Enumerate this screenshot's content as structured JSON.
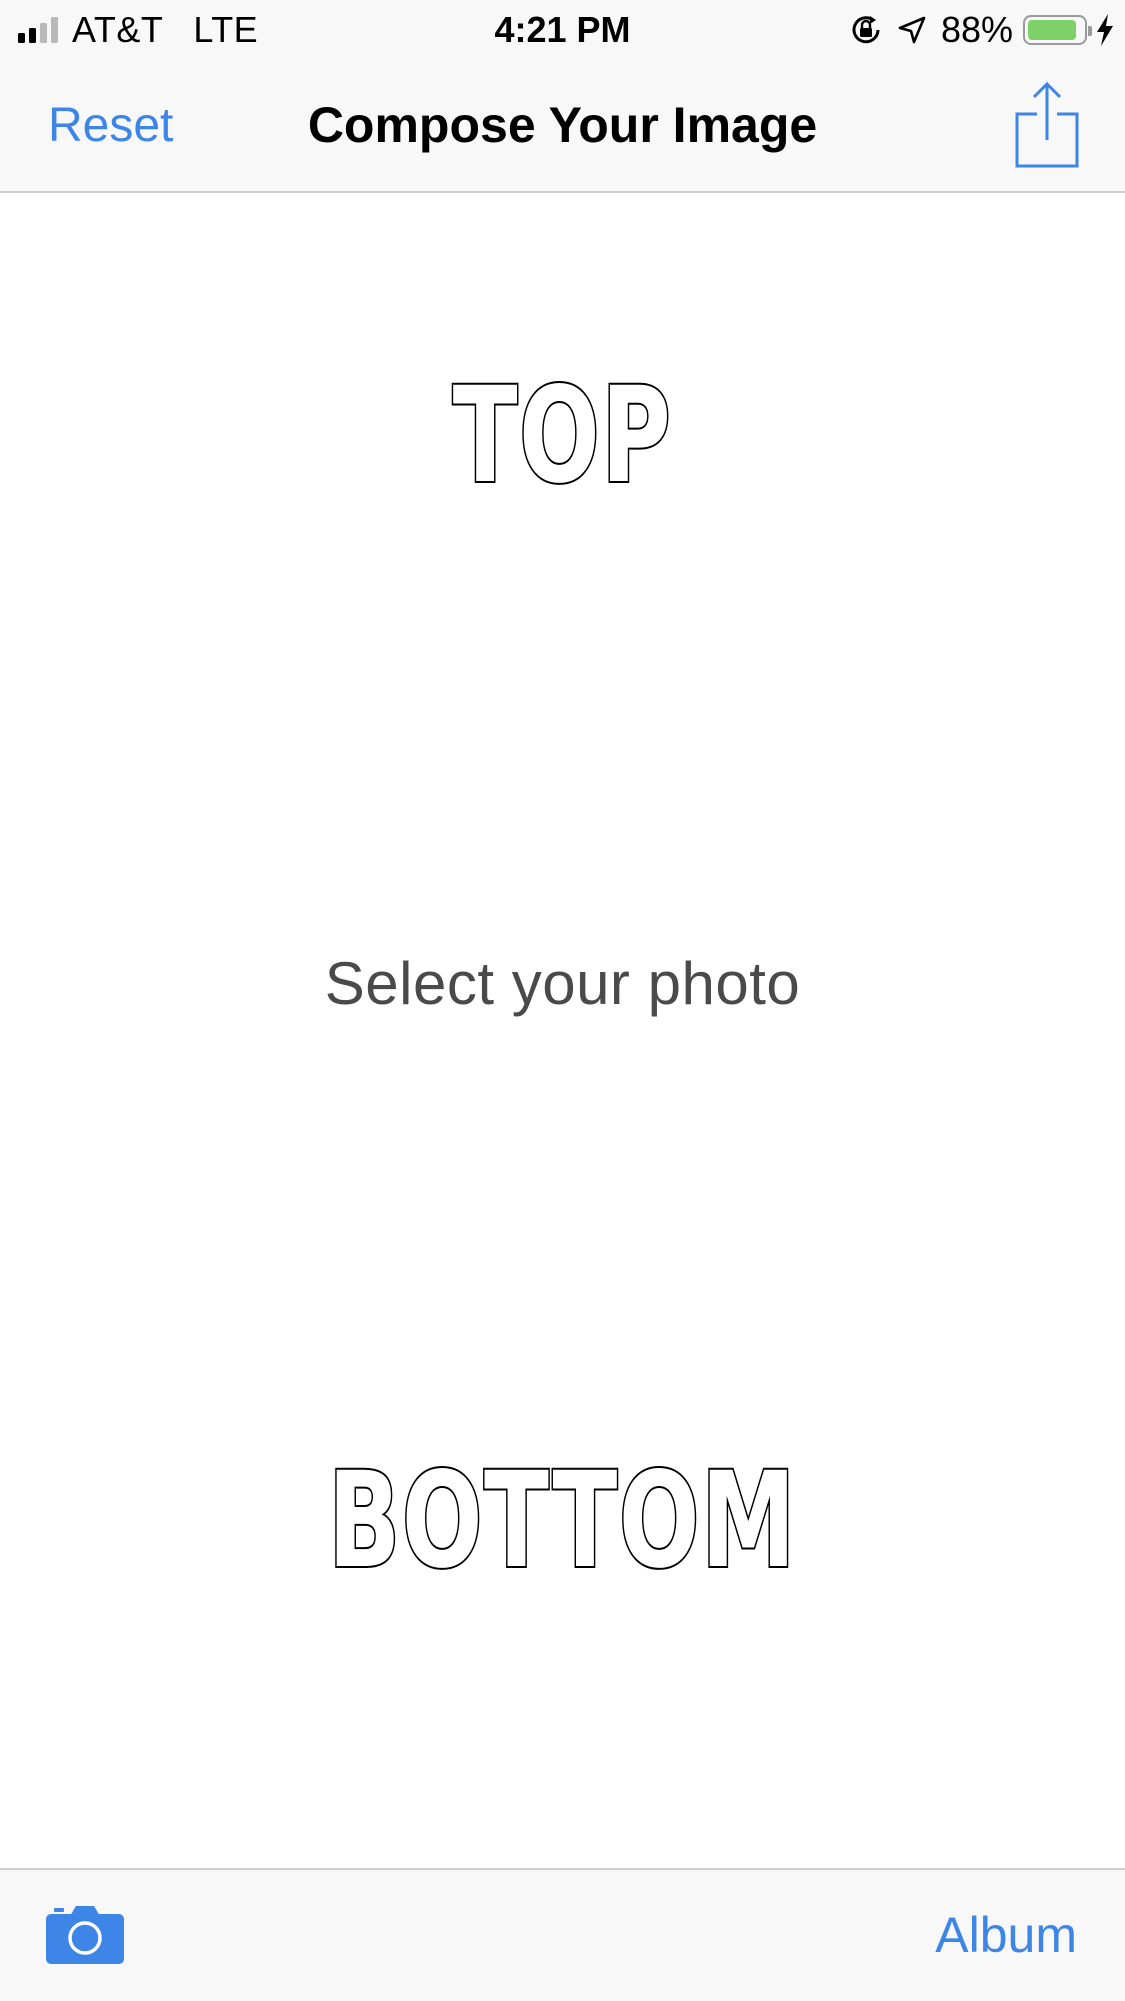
{
  "colors": {
    "accent": "#3d85e6",
    "battery": "#7ed168",
    "placeholder": "#4a4a4a"
  },
  "status_bar": {
    "carrier": "AT&T",
    "network": "LTE",
    "time": "4:21 PM",
    "battery_percent": "88%",
    "battery_level": 0.88,
    "signal_bars_filled": 2,
    "signal_bars_total": 4,
    "icons": [
      "signal-icon",
      "orientation-lock-icon",
      "location-arrow-icon",
      "battery-icon",
      "charging-bolt-icon"
    ]
  },
  "nav_bar": {
    "left_button": "Reset",
    "title": "Compose Your Image",
    "right_icon": "share-icon"
  },
  "canvas": {
    "top_text": "TOP",
    "placeholder": "Select your photo",
    "bottom_text": "BOTTOM"
  },
  "toolbar": {
    "left_icon": "camera-icon",
    "right_button": "Album"
  }
}
